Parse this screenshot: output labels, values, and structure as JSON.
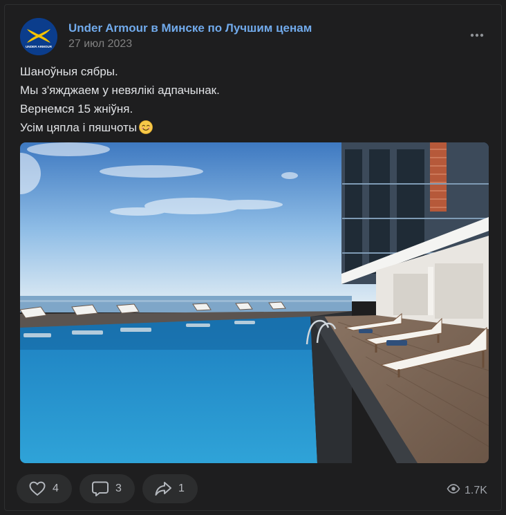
{
  "post": {
    "author": "Under Armour в Минске по Лучшим ценам",
    "date": "27 июл 2023",
    "avatar_text": "UNDER ARMOUR",
    "text_lines": [
      "Шаноўныя сябры.",
      "Мы з'яжджаем у невялікі адпачынак.",
      "Вернемся 15 жніўня.",
      "Усім цяпла і пяшчоты"
    ],
    "emoji": "smiling-face-emoji",
    "photo": "hotel-infinity-pool-sea-view"
  },
  "actions": {
    "likes": "4",
    "comments": "3",
    "shares": "1",
    "views": "1.7K"
  },
  "icons": {
    "like": "heart-icon",
    "comment": "comment-bubble-icon",
    "share": "share-arrow-icon",
    "views": "eye-icon",
    "more": "more-dots-icon"
  },
  "colors": {
    "background": "#1e1e1f",
    "author_link": "#71aaeb",
    "secondary_text": "#828282",
    "button_bg": "#2c2d2e",
    "avatar_bg": "#0b3d8c",
    "logo_yellow": "#f3c200"
  }
}
